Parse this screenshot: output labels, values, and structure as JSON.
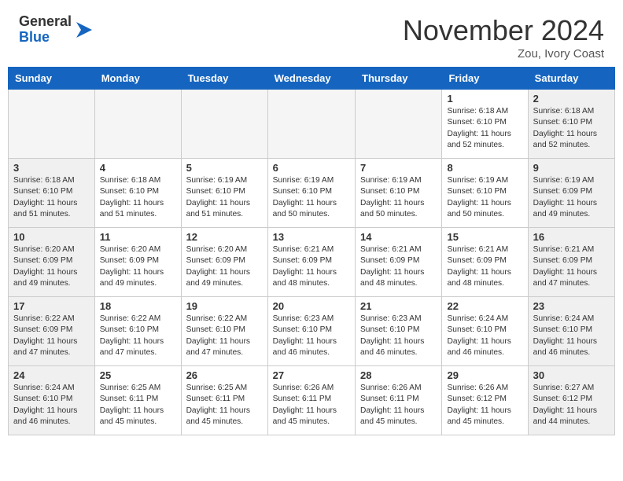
{
  "logo": {
    "general": "General",
    "blue": "Blue"
  },
  "header": {
    "month": "November 2024",
    "location": "Zou, Ivory Coast"
  },
  "weekdays": [
    "Sunday",
    "Monday",
    "Tuesday",
    "Wednesday",
    "Thursday",
    "Friday",
    "Saturday"
  ],
  "weeks": [
    [
      {
        "day": "",
        "info": ""
      },
      {
        "day": "",
        "info": ""
      },
      {
        "day": "",
        "info": ""
      },
      {
        "day": "",
        "info": ""
      },
      {
        "day": "",
        "info": ""
      },
      {
        "day": "1",
        "info": "Sunrise: 6:18 AM\nSunset: 6:10 PM\nDaylight: 11 hours\nand 52 minutes."
      },
      {
        "day": "2",
        "info": "Sunrise: 6:18 AM\nSunset: 6:10 PM\nDaylight: 11 hours\nand 52 minutes."
      }
    ],
    [
      {
        "day": "3",
        "info": "Sunrise: 6:18 AM\nSunset: 6:10 PM\nDaylight: 11 hours\nand 51 minutes."
      },
      {
        "day": "4",
        "info": "Sunrise: 6:18 AM\nSunset: 6:10 PM\nDaylight: 11 hours\nand 51 minutes."
      },
      {
        "day": "5",
        "info": "Sunrise: 6:19 AM\nSunset: 6:10 PM\nDaylight: 11 hours\nand 51 minutes."
      },
      {
        "day": "6",
        "info": "Sunrise: 6:19 AM\nSunset: 6:10 PM\nDaylight: 11 hours\nand 50 minutes."
      },
      {
        "day": "7",
        "info": "Sunrise: 6:19 AM\nSunset: 6:10 PM\nDaylight: 11 hours\nand 50 minutes."
      },
      {
        "day": "8",
        "info": "Sunrise: 6:19 AM\nSunset: 6:10 PM\nDaylight: 11 hours\nand 50 minutes."
      },
      {
        "day": "9",
        "info": "Sunrise: 6:19 AM\nSunset: 6:09 PM\nDaylight: 11 hours\nand 49 minutes."
      }
    ],
    [
      {
        "day": "10",
        "info": "Sunrise: 6:20 AM\nSunset: 6:09 PM\nDaylight: 11 hours\nand 49 minutes."
      },
      {
        "day": "11",
        "info": "Sunrise: 6:20 AM\nSunset: 6:09 PM\nDaylight: 11 hours\nand 49 minutes."
      },
      {
        "day": "12",
        "info": "Sunrise: 6:20 AM\nSunset: 6:09 PM\nDaylight: 11 hours\nand 49 minutes."
      },
      {
        "day": "13",
        "info": "Sunrise: 6:21 AM\nSunset: 6:09 PM\nDaylight: 11 hours\nand 48 minutes."
      },
      {
        "day": "14",
        "info": "Sunrise: 6:21 AM\nSunset: 6:09 PM\nDaylight: 11 hours\nand 48 minutes."
      },
      {
        "day": "15",
        "info": "Sunrise: 6:21 AM\nSunset: 6:09 PM\nDaylight: 11 hours\nand 48 minutes."
      },
      {
        "day": "16",
        "info": "Sunrise: 6:21 AM\nSunset: 6:09 PM\nDaylight: 11 hours\nand 47 minutes."
      }
    ],
    [
      {
        "day": "17",
        "info": "Sunrise: 6:22 AM\nSunset: 6:09 PM\nDaylight: 11 hours\nand 47 minutes."
      },
      {
        "day": "18",
        "info": "Sunrise: 6:22 AM\nSunset: 6:10 PM\nDaylight: 11 hours\nand 47 minutes."
      },
      {
        "day": "19",
        "info": "Sunrise: 6:22 AM\nSunset: 6:10 PM\nDaylight: 11 hours\nand 47 minutes."
      },
      {
        "day": "20",
        "info": "Sunrise: 6:23 AM\nSunset: 6:10 PM\nDaylight: 11 hours\nand 46 minutes."
      },
      {
        "day": "21",
        "info": "Sunrise: 6:23 AM\nSunset: 6:10 PM\nDaylight: 11 hours\nand 46 minutes."
      },
      {
        "day": "22",
        "info": "Sunrise: 6:24 AM\nSunset: 6:10 PM\nDaylight: 11 hours\nand 46 minutes."
      },
      {
        "day": "23",
        "info": "Sunrise: 6:24 AM\nSunset: 6:10 PM\nDaylight: 11 hours\nand 46 minutes."
      }
    ],
    [
      {
        "day": "24",
        "info": "Sunrise: 6:24 AM\nSunset: 6:10 PM\nDaylight: 11 hours\nand 46 minutes."
      },
      {
        "day": "25",
        "info": "Sunrise: 6:25 AM\nSunset: 6:11 PM\nDaylight: 11 hours\nand 45 minutes."
      },
      {
        "day": "26",
        "info": "Sunrise: 6:25 AM\nSunset: 6:11 PM\nDaylight: 11 hours\nand 45 minutes."
      },
      {
        "day": "27",
        "info": "Sunrise: 6:26 AM\nSunset: 6:11 PM\nDaylight: 11 hours\nand 45 minutes."
      },
      {
        "day": "28",
        "info": "Sunrise: 6:26 AM\nSunset: 6:11 PM\nDaylight: 11 hours\nand 45 minutes."
      },
      {
        "day": "29",
        "info": "Sunrise: 6:26 AM\nSunset: 6:12 PM\nDaylight: 11 hours\nand 45 minutes."
      },
      {
        "day": "30",
        "info": "Sunrise: 6:27 AM\nSunset: 6:12 PM\nDaylight: 11 hours\nand 44 minutes."
      }
    ]
  ]
}
